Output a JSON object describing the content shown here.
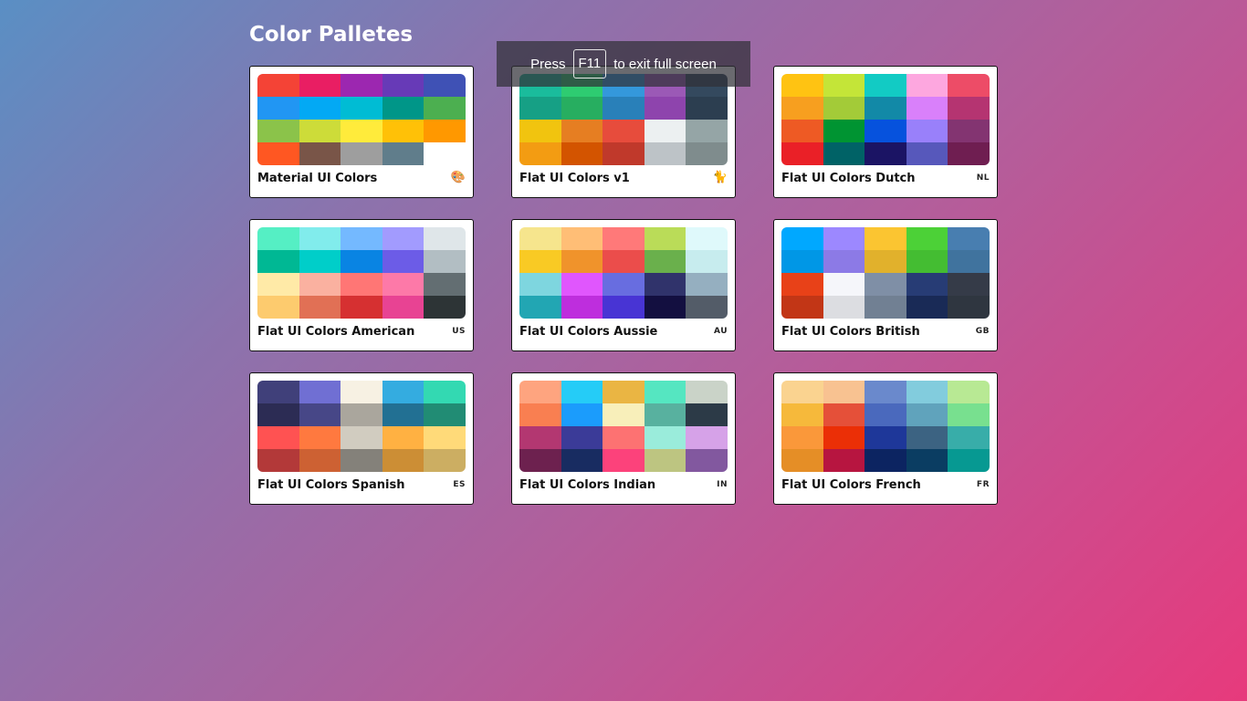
{
  "header": {
    "title": "Color Palletes"
  },
  "toast": {
    "press": "Press",
    "key": "F11",
    "suffix": "to exit full screen"
  },
  "palettes": [
    {
      "name": "Material UI Colors",
      "badge": "🎨",
      "badge_type": "emoji",
      "colors": [
        "#f44336",
        "#e91e63",
        "#9c27b0",
        "#673ab7",
        "#3f51b5",
        "#2196f3",
        "#03a9f4",
        "#00bcd4",
        "#009688",
        "#4caf50",
        "#8bc34a",
        "#cddc39",
        "#ffeb3b",
        "#ffc107",
        "#ff9800",
        "#ff5722",
        "#795548",
        "#9e9e9e",
        "#607d8b",
        "#ffffff"
      ]
    },
    {
      "name": "Flat UI Colors v1",
      "badge": "🐈",
      "badge_type": "emoji",
      "colors": [
        "#1abc9c",
        "#2ecc71",
        "#3498db",
        "#9b59b6",
        "#34495e",
        "#16a085",
        "#27ae60",
        "#2980b9",
        "#8e44ad",
        "#2c3e50",
        "#f1c40f",
        "#e67e22",
        "#e74c3c",
        "#ecf0f1",
        "#95a5a6",
        "#f39c12",
        "#d35400",
        "#c0392b",
        "#bdc3c7",
        "#7f8c8d"
      ]
    },
    {
      "name": "Flat UI Colors Dutch",
      "badge": "NL",
      "badge_type": "text",
      "colors": [
        "#ffc312",
        "#c4e538",
        "#12cbc4",
        "#fda7df",
        "#ed4c67",
        "#f79f1f",
        "#a3cb38",
        "#1289a7",
        "#d980fa",
        "#b53471",
        "#ee5a24",
        "#009432",
        "#0652dd",
        "#9980fa",
        "#833471",
        "#ea2027",
        "#006266",
        "#1b1464",
        "#5758bb",
        "#6f1e51"
      ]
    },
    {
      "name": "Flat UI Colors American",
      "badge": "US",
      "badge_type": "text",
      "colors": [
        "#55efc4",
        "#81ecec",
        "#74b9ff",
        "#a29bfe",
        "#dfe6e9",
        "#00b894",
        "#00cec9",
        "#0984e3",
        "#6c5ce7",
        "#b2bec3",
        "#ffeaa7",
        "#fab1a0",
        "#ff7675",
        "#fd79a8",
        "#636e72",
        "#fdcb6e",
        "#e17055",
        "#d63031",
        "#e84393",
        "#2d3436"
      ]
    },
    {
      "name": "Flat UI Colors Aussie",
      "badge": "AU",
      "badge_type": "text",
      "colors": [
        "#f6e58d",
        "#ffbe76",
        "#ff7979",
        "#badc58",
        "#dff9fb",
        "#f9ca24",
        "#f0932b",
        "#eb4d4b",
        "#6ab04c",
        "#c7ecee",
        "#7ed6df",
        "#e056fd",
        "#686de0",
        "#30336b",
        "#95afc0",
        "#22a6b3",
        "#be2edd",
        "#4834d4",
        "#130f40",
        "#535c68"
      ]
    },
    {
      "name": "Flat UI Colors British",
      "badge": "GB",
      "badge_type": "text",
      "colors": [
        "#00a8ff",
        "#9c88ff",
        "#fbc531",
        "#4cd137",
        "#487eb0",
        "#0097e6",
        "#8c7ae6",
        "#e1b12c",
        "#44bd32",
        "#40739e",
        "#e84118",
        "#f5f6fa",
        "#7f8fa6",
        "#273c75",
        "#353b48",
        "#c23616",
        "#dcdde1",
        "#718093",
        "#192a56",
        "#2f3640"
      ]
    },
    {
      "name": "Flat UI Colors Spanish",
      "badge": "ES",
      "badge_type": "text",
      "colors": [
        "#40407a",
        "#706fd3",
        "#f7f1e3",
        "#34ace0",
        "#33d9b2",
        "#2c2c54",
        "#474787",
        "#aaa69d",
        "#227093",
        "#218c74",
        "#ff5252",
        "#ff793f",
        "#d1ccc0",
        "#ffb142",
        "#ffda79",
        "#b33939",
        "#cd6133",
        "#84817a",
        "#cc8e35",
        "#ccae62"
      ]
    },
    {
      "name": "Flat UI Colors Indian",
      "badge": "IN",
      "badge_type": "text",
      "colors": [
        "#fea47f",
        "#25ccf7",
        "#eab543",
        "#55e6c1",
        "#cad3c8",
        "#f97f51",
        "#1b9cfc",
        "#f8efba",
        "#58b19f",
        "#2c3a47",
        "#b33771",
        "#3b3b98",
        "#fd7272",
        "#9aecdb",
        "#d6a2e8",
        "#6d214f",
        "#182c61",
        "#fc427b",
        "#bdc581",
        "#82589f"
      ]
    },
    {
      "name": "Flat UI Colors French",
      "badge": "FR",
      "badge_type": "text",
      "colors": [
        "#fad390",
        "#f8c291",
        "#6a89cc",
        "#82ccdd",
        "#b8e994",
        "#f6b93b",
        "#e55039",
        "#4a69bd",
        "#60a3bc",
        "#78e08f",
        "#fa983a",
        "#eb2f06",
        "#1e3799",
        "#3c6382",
        "#38ada9",
        "#e58e26",
        "#b71540",
        "#0c2461",
        "#0a3d62",
        "#079992"
      ]
    }
  ]
}
